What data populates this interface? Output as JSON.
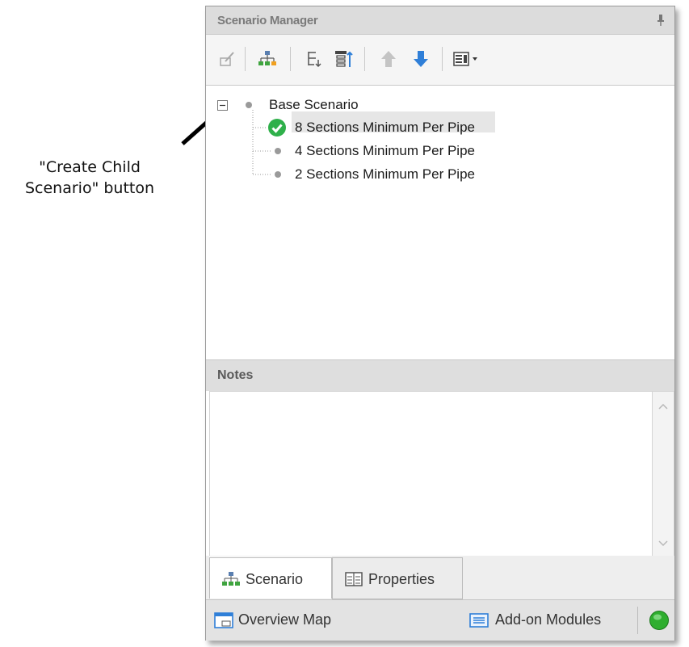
{
  "annotation": {
    "callout_line1": "\"Create Child",
    "callout_line2": "Scenario\" button"
  },
  "panel": {
    "title": "Scenario Manager"
  },
  "toolbar": {
    "buttons": [
      {
        "icon": "edit-scenario-icon"
      },
      {
        "icon": "create-child-scenario-icon"
      },
      {
        "icon": "collapse-tree-icon"
      },
      {
        "icon": "expand-tree-icon"
      },
      {
        "icon": "move-up-icon"
      },
      {
        "icon": "move-down-icon"
      },
      {
        "icon": "view-options-dropdown-icon"
      }
    ]
  },
  "tree": {
    "root": {
      "label": "Base Scenario",
      "expanded": true
    },
    "children": [
      {
        "label": "8 Sections Minimum Per Pipe",
        "status": "current"
      },
      {
        "label": "4 Sections Minimum Per Pipe",
        "status": "inactive"
      },
      {
        "label": "2 Sections Minimum Per Pipe",
        "status": "inactive"
      }
    ]
  },
  "notes": {
    "header": "Notes",
    "text": ""
  },
  "tabs": [
    {
      "label": "Scenario",
      "active": true
    },
    {
      "label": "Properties",
      "active": false
    }
  ],
  "bottombar": {
    "overview_label": "Overview Map",
    "addon_label": "Add-on Modules",
    "status_color": "#2fae2f"
  },
  "colors": {
    "accent_blue": "#2f7fd8",
    "check_green": "#2fb04a"
  }
}
